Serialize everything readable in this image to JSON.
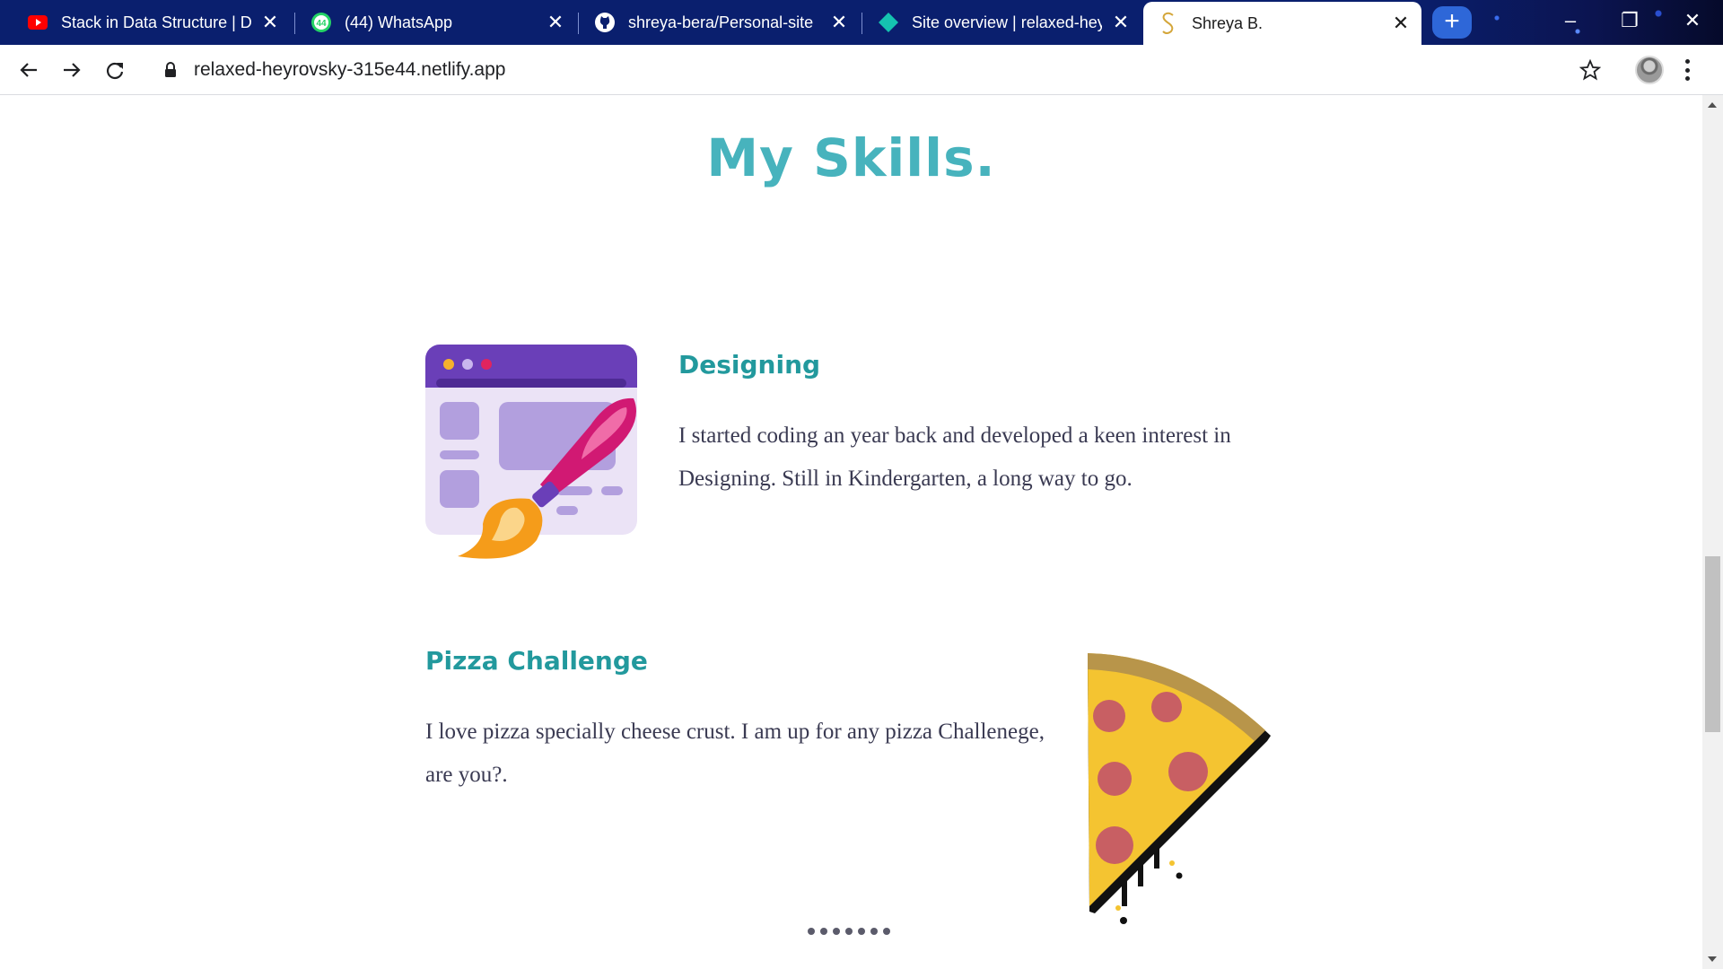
{
  "browser": {
    "tabs": [
      {
        "title": "Stack in Data Structure | Data",
        "favicon": "youtube-icon"
      },
      {
        "title": "(44) WhatsApp",
        "favicon": "whatsapp-icon",
        "badge": "44"
      },
      {
        "title": "shreya-bera/Personal-site",
        "favicon": "github-icon"
      },
      {
        "title": "Site overview | relaxed-heyrovsky",
        "favicon": "netlify-icon"
      },
      {
        "title": "Shreya B.",
        "favicon": "site-s-icon",
        "active": true
      }
    ],
    "new_tab_label": "+",
    "url": "relaxed-heyrovsky-315e44.netlify.app"
  },
  "page": {
    "section_title": "My Skills.",
    "skills": [
      {
        "heading": "Designing",
        "text_line1": "I started coding an year back and developed a keen interest in",
        "text_line2": "Designing. Still in Kindergarten, a long way to go.",
        "icon": "design-brush-icon"
      },
      {
        "heading": "Pizza Challenge",
        "text_line1": "I love pizza specially cheese crust. I am up for any pizza Challenege,",
        "text_line2": "are you?.",
        "icon": "pizza-slice-icon"
      }
    ]
  },
  "colors": {
    "title": "#47b3bd",
    "heading": "#22999d",
    "body_text": "#3a3a52",
    "tabstrip": "#0a1f6e"
  }
}
